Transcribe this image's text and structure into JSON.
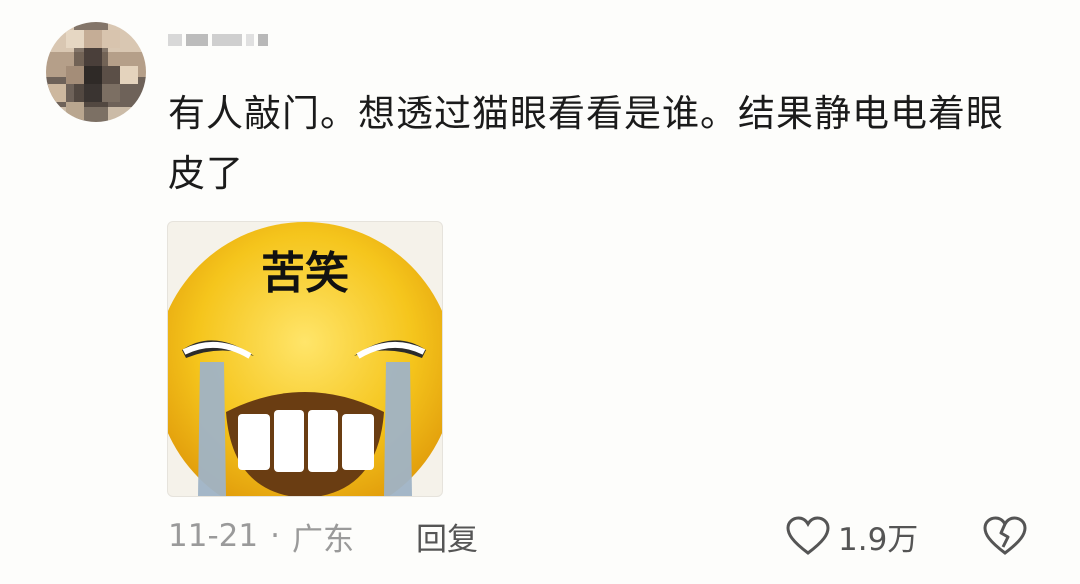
{
  "comment": {
    "username": "",
    "text": "有人敲门。想透过猫眼看看是谁。结果静电电着眼皮了",
    "sticker_caption": "苦笑",
    "date": "11-21",
    "separator": "·",
    "location": "广东",
    "reply_label": "回复",
    "like_count": "1.9万"
  },
  "icons": {
    "like": "heart-outline-icon",
    "dislike": "broken-heart-icon"
  },
  "colors": {
    "background": "#fdfdfb",
    "text": "#1b1b1b",
    "meta": "#9a9a9a",
    "action": "#555555",
    "emoji_face": "#f3c31b"
  }
}
